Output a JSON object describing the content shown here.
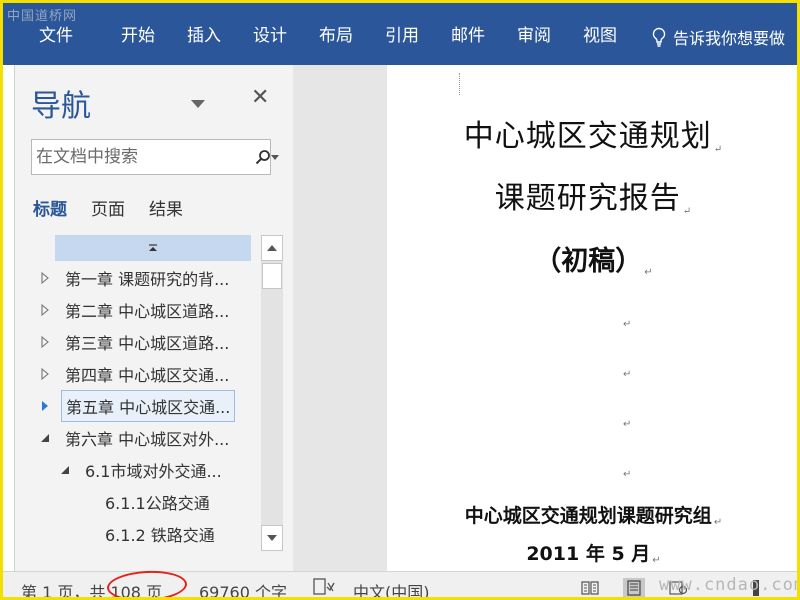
{
  "watermark_top": "中国道桥网",
  "watermark_bottom": "www.cndao.com",
  "ribbon": {
    "tabs": [
      "文件",
      "开始",
      "插入",
      "设计",
      "布局",
      "引用",
      "邮件",
      "审阅",
      "视图"
    ],
    "tell_me": "告诉我你想要做"
  },
  "nav": {
    "title": "导航",
    "search_placeholder": "在文档中搜索",
    "tabs": [
      "标题",
      "页面",
      "结果"
    ],
    "active_tab": "标题",
    "headings": [
      {
        "label": "第一章 课题研究的背...",
        "level": 1,
        "state": "collapsed"
      },
      {
        "label": "第二章 中心城区道路...",
        "level": 1,
        "state": "collapsed"
      },
      {
        "label": "第三章 中心城区道路...",
        "level": 1,
        "state": "collapsed"
      },
      {
        "label": "第四章 中心城区交通...",
        "level": 1,
        "state": "collapsed"
      },
      {
        "label": "第五章 中心城区交通...",
        "level": 1,
        "state": "collapsed",
        "selected": true
      },
      {
        "label": "第六章 中心城区对外...",
        "level": 1,
        "state": "expanded"
      },
      {
        "label": "6.1市域对外交通...",
        "level": 2,
        "state": "expanded"
      },
      {
        "label": "6.1.1公路交通",
        "level": 3,
        "state": "none"
      },
      {
        "label": "6.1.2 铁路交通",
        "level": 3,
        "state": "none"
      }
    ]
  },
  "document": {
    "title_line1": "中心城区交通规划",
    "title_line2": "课题研究报告",
    "subtitle": "（初稿）",
    "organization": "中心城区交通规划课题研究组",
    "date": "2011 年 5 月"
  },
  "status": {
    "page_info": "第 1 页，共 108 页",
    "word_count": "69760 个字",
    "language": "中文(中国)"
  },
  "colors": {
    "ribbon": "#2b579a",
    "frame": "#f3e000",
    "highlight_oval": "#e2231a",
    "nav_heading_bar": "#c6d8f0"
  }
}
